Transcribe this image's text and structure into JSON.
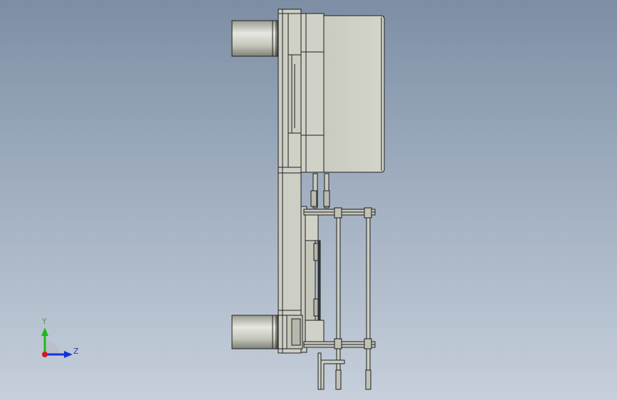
{
  "triad": {
    "y_label": "Y",
    "z_label": "Z",
    "colors": {
      "y_axis": "#1db81d",
      "z_axis": "#1433d6",
      "x_origin": "#d11a1a",
      "label_y": "#4a9c4a",
      "label_z": "#2a3fa8"
    }
  },
  "colors": {
    "background_top": "#7d8ea4",
    "background_bottom": "#c6cfdb",
    "part_fill": "#cfd1c6",
    "part_shade": "#b9bcae",
    "cylinder_light": "#e2e3dc",
    "cylinder_dark": "#8e9184",
    "edge": "#1f1f1f"
  }
}
